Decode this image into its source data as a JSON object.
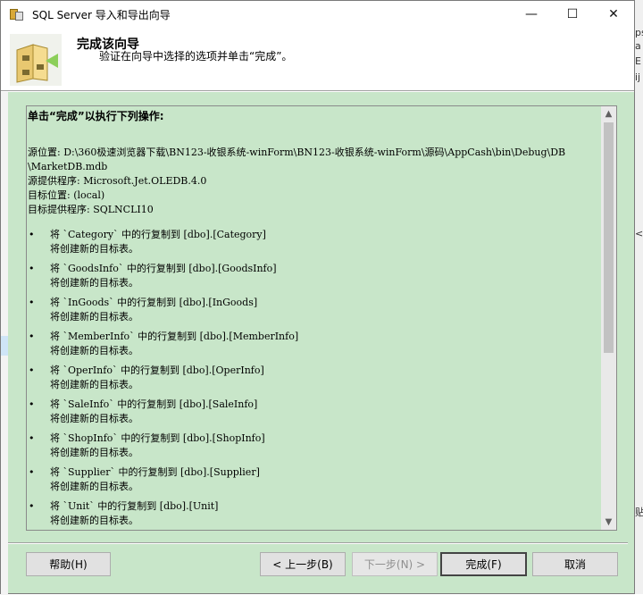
{
  "window": {
    "title": "SQL Server 导入和导出向导",
    "controls": {
      "minimize": "—",
      "maximize": "☐",
      "close": "✕"
    }
  },
  "header": {
    "title": "完成该向导",
    "subtitle": "验证在向导中选择的选项并单击“完成”。"
  },
  "summary": {
    "heading": "单击“完成”以执行下列操作:",
    "source_location_1": "源位置: D:\\360极速浏览器下载\\BN123-收银系统-winForm\\BN123-收银系统-winForm\\源码\\AppCash\\bin\\Debug\\DB",
    "source_location_2": "\\MarketDB.mdb",
    "source_provider": "源提供程序: Microsoft.Jet.OLEDB.4.0",
    "dest_location": "目标位置: (local)",
    "dest_provider": "目标提供程序: SQLNCLI10",
    "bullet": "•",
    "operations": [
      {
        "copy": "将 `Category` 中的行复制到 [dbo].[Category]",
        "note": "将创建新的目标表。"
      },
      {
        "copy": "将 `GoodsInfo` 中的行复制到 [dbo].[GoodsInfo]",
        "note": "将创建新的目标表。"
      },
      {
        "copy": "将 `InGoods` 中的行复制到 [dbo].[InGoods]",
        "note": "将创建新的目标表。"
      },
      {
        "copy": "将 `MemberInfo` 中的行复制到 [dbo].[MemberInfo]",
        "note": "将创建新的目标表。"
      },
      {
        "copy": "将 `OperInfo` 中的行复制到 [dbo].[OperInfo]",
        "note": "将创建新的目标表。"
      },
      {
        "copy": "将 `SaleInfo` 中的行复制到 [dbo].[SaleInfo]",
        "note": "将创建新的目标表。"
      },
      {
        "copy": "将 `ShopInfo` 中的行复制到 [dbo].[ShopInfo]",
        "note": "将创建新的目标表。"
      },
      {
        "copy": "将 `Supplier` 中的行复制到 [dbo].[Supplier]",
        "note": "将创建新的目标表。"
      },
      {
        "copy": "将 `Unit` 中的行复制到 [dbo].[Unit]",
        "note": "将创建新的目标表。"
      }
    ]
  },
  "scrollbar": {
    "up": "▲",
    "down": "▼"
  },
  "buttons": {
    "help": "帮助(H)",
    "back": "< 上一步(B)",
    "next": "下一步(N) >",
    "finish": "完成(F)",
    "cancel": "取消"
  },
  "colors": {
    "panel_bg": "#c8e6c9",
    "window_bg": "#ffffff",
    "button_bg": "#e1e1e1"
  },
  "background_app": {
    "marks": [
      "ps",
      "a",
      "E",
      "ij",
      "<",
      "贴"
    ]
  }
}
